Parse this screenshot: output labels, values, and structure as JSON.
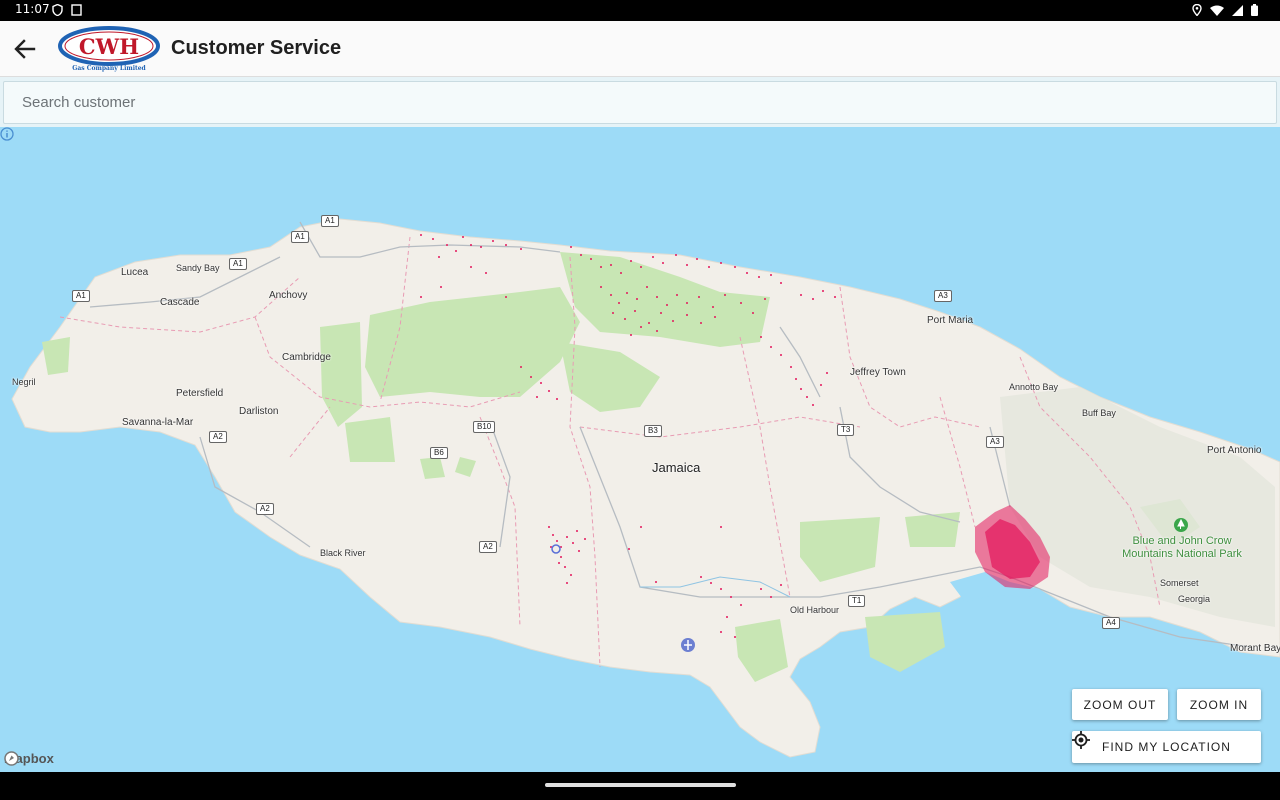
{
  "status_bar": {
    "time": "11:07",
    "icons_left": [
      "vpn-shield-icon",
      "screen-icon"
    ],
    "icons_right": [
      "location-icon",
      "wifi-icon",
      "signal-icon",
      "battery-icon"
    ]
  },
  "app_bar": {
    "title": "Customer Service",
    "logo_text": "CWH",
    "logo_subtext": "Gas Company Limited",
    "back_icon": "back-arrow-icon"
  },
  "search": {
    "placeholder": "Search customer",
    "value": ""
  },
  "map": {
    "country_label": "Jamaica",
    "places": [
      "Lucea",
      "Sandy Bay",
      "Anchovy",
      "Cascade",
      "Negril",
      "Cambridge",
      "Petersfield",
      "Darliston",
      "Savanna-la-Mar",
      "Black River",
      "Port Maria",
      "Jeffrey Town",
      "Annotto Bay",
      "Buff Bay",
      "Port Antonio",
      "Somerset",
      "Georgia",
      "Old Harbour",
      "Morant Bay"
    ],
    "park_label": "Blue and John Crow Mountains National Park",
    "road_shields": [
      "A1",
      "A1",
      "A1",
      "A1",
      "A2",
      "A2",
      "A2",
      "B10",
      "B6",
      "B3",
      "A3",
      "A3",
      "T3",
      "T1",
      "A4"
    ],
    "attribution": "mapbox",
    "colors": {
      "water": "#9ddbf7",
      "land": "#f2efe9",
      "forest": "#c8e6b4",
      "marker": "#e3165b"
    }
  },
  "controls": {
    "zoom_out": "ZOOM OUT",
    "zoom_in": "ZOOM IN",
    "find_location": "FIND MY LOCATION"
  }
}
